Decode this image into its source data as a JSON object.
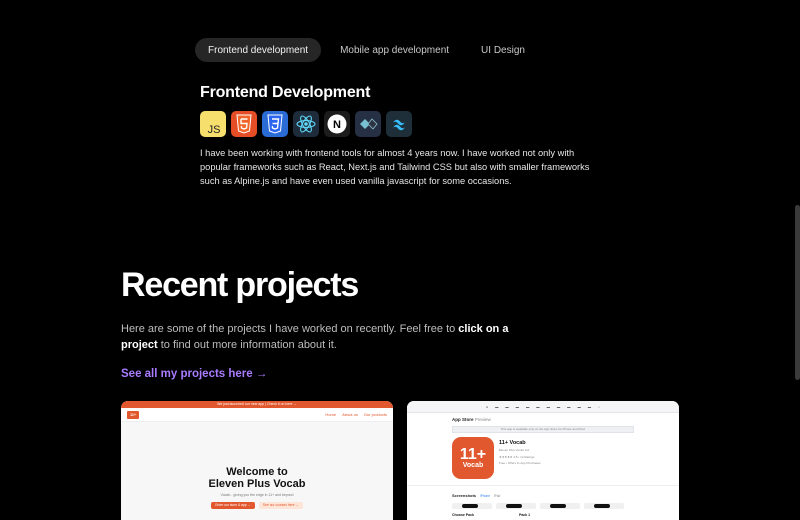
{
  "tabs": [
    {
      "label": "Frontend development",
      "active": true
    },
    {
      "label": "Mobile app development",
      "active": false
    },
    {
      "label": "UI Design",
      "active": false
    }
  ],
  "skill": {
    "title": "Frontend Development",
    "icons": [
      "javascript-icon",
      "html5-icon",
      "css3-icon",
      "react-icon",
      "nextjs-icon",
      "alpinejs-icon",
      "tailwindcss-icon"
    ],
    "description": "I have been working with frontend tools for almost 4 years now. I have worked not only with popular frameworks such as React, Next.js and Tailwind CSS but also with smaller frameworks such as Alpine.js and have even used vanilla javascript for some occasions."
  },
  "recent": {
    "title": "Recent projects",
    "desc_before": "Here are some of the projects I have worked on recently. Feel free to ",
    "desc_bold": "click on a project",
    "desc_after": " to find out more information about it.",
    "link": "See all my projects here →"
  },
  "project1": {
    "banner": "We just launched our new app | Check it on here →",
    "logo": "11+",
    "nav": [
      "Home",
      "About us",
      "Our products"
    ],
    "heading_line1": "Welcome to",
    "heading_line2": "Eleven Plus Vocab",
    "sub": "Vocab - giving you the edge in 11+ and beyond",
    "btn1": "Enter our store & app →",
    "btn2": "See our courses here →"
  },
  "project2": {
    "store_label": "App Store",
    "store_sub": "Preview",
    "notice": "This app is available only on the App Store for iPhone and iPad.",
    "app_name": "11+ Vocab",
    "icon_top": "11+",
    "icon_bottom": "Vocab",
    "meta1": "Eleven Plus Vocab Ltd",
    "meta2": "★★★★★ 4.8 • 12 Ratings",
    "meta3": "Free • Offers In-App Purchases",
    "screenshots": "Screenshots",
    "tab_iphone": "iPhone",
    "tab_ipad": "iPad",
    "label1": "Choose Pack",
    "label2": "Pack 1",
    "colors": {
      "brand": "#e2582e"
    }
  },
  "colors": {
    "accent": "#a97bff",
    "background": "#000000"
  }
}
